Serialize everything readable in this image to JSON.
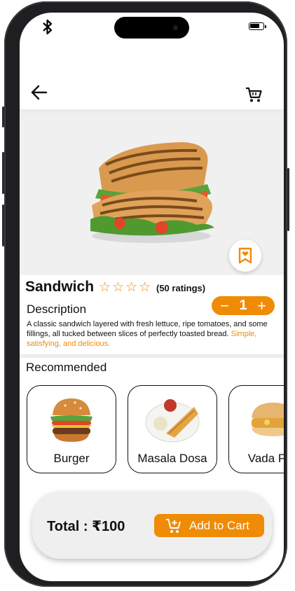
{
  "app": {
    "brand_color": "#f08b06",
    "status_bar": {
      "icons": [
        "bluetooth-icon",
        "battery-icon"
      ]
    }
  },
  "product": {
    "name": "Sandwich",
    "rating": {
      "stars_filled": 0,
      "stars_total": 5,
      "count_label": "(50 ratings)"
    },
    "description_heading": "Description",
    "description_text": "A classic sandwich layered with fresh lettuce, ripe tomatoes, and some fillings, all tucked between slices of perfectly toasted bread.",
    "description_highlight": "Simple, satisfying, and delicious.",
    "quantity": {
      "minus": "−",
      "value": "1",
      "plus": "+"
    },
    "icons": {
      "back": "arrow-left-icon",
      "cart": "cart-icon",
      "favorite": "bookmark-heart-icon"
    }
  },
  "recommended": {
    "heading": "Recommended",
    "items": [
      {
        "label": "Burger",
        "icon": "burger-image"
      },
      {
        "label": "Masala Dosa",
        "icon": "dosa-image"
      },
      {
        "label": "Vada Pav",
        "icon": "vada-pav-image"
      }
    ]
  },
  "checkout": {
    "total_label": "Total : ₹100",
    "add_to_cart_label": "Add to Cart",
    "icon": "cart-plus-icon"
  }
}
